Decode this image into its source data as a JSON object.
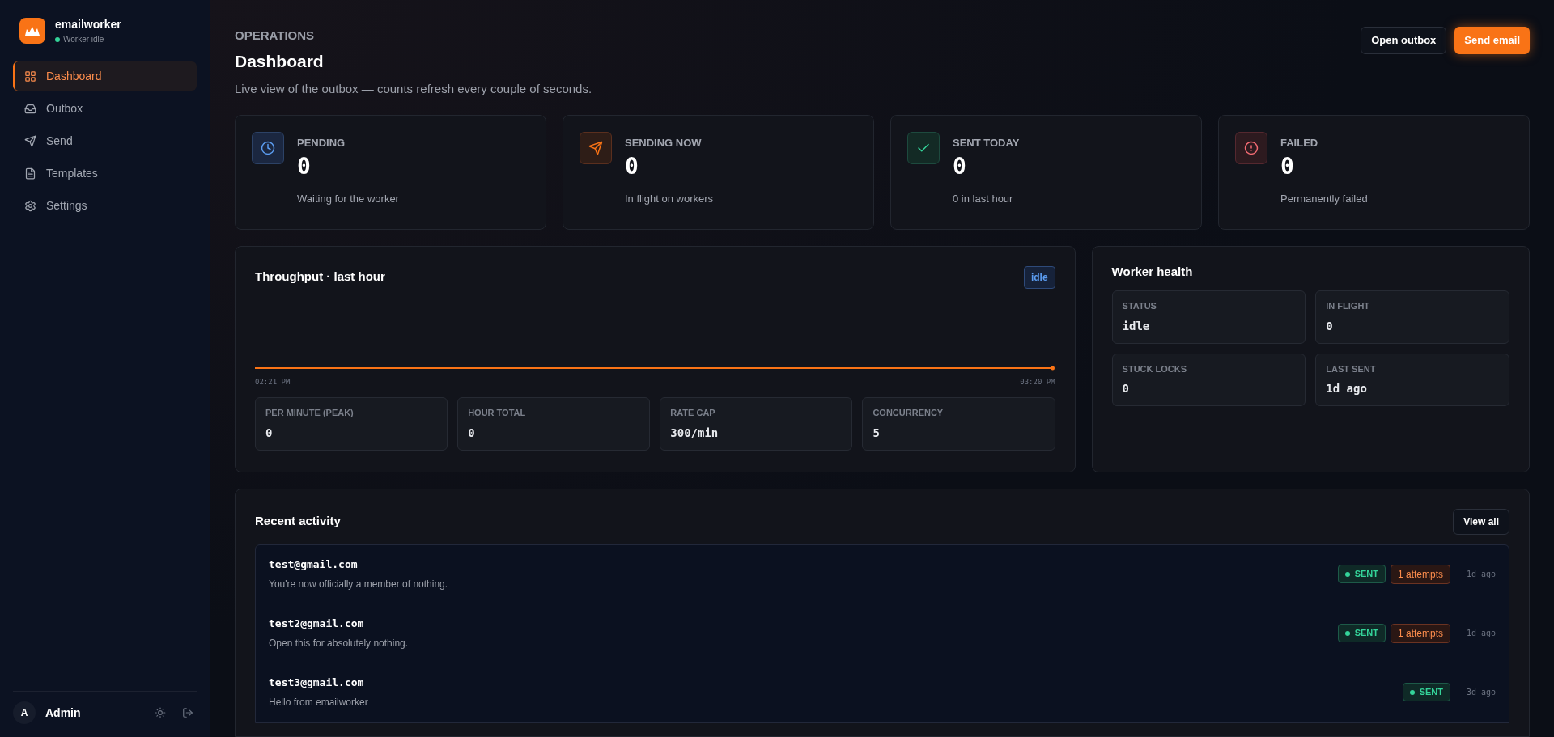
{
  "sidebar": {
    "app_name": "emailworker",
    "worker_status": "Worker idle",
    "items": [
      {
        "label": "Dashboard",
        "kind": "dashboard",
        "selected": true
      },
      {
        "label": "Outbox",
        "kind": "outbox",
        "selected": false
      },
      {
        "label": "Send",
        "kind": "send",
        "selected": false
      },
      {
        "label": "Templates",
        "kind": "templates",
        "selected": false
      },
      {
        "label": "Settings",
        "kind": "settings",
        "selected": false
      }
    ],
    "user": {
      "initial": "A",
      "name": "Admin"
    }
  },
  "header": {
    "eyebrow": "OPERATIONS",
    "title": "Dashboard",
    "subtitle": "Live view of the outbox — counts refresh every couple of seconds.",
    "buttons": [
      {
        "label": "Open outbox",
        "kind": "secondary"
      },
      {
        "label": "Send email",
        "kind": "primary"
      }
    ]
  },
  "stats": [
    {
      "kind": "pending",
      "label": "PENDING",
      "value": "0",
      "caption": "Waiting for the worker"
    },
    {
      "kind": "sending",
      "label": "SENDING NOW",
      "value": "0",
      "caption": "In flight on workers"
    },
    {
      "kind": "sent",
      "label": "SENT TODAY",
      "value": "0",
      "caption": "0 in last hour"
    },
    {
      "kind": "failed",
      "label": "FAILED",
      "value": "0",
      "caption": "Permanently failed"
    }
  ],
  "throughput": {
    "title": "Throughput · last hour",
    "badge": "idle",
    "x_start": "02:21 PM",
    "x_end": "03:20 PM",
    "metrics": [
      {
        "label": "PER MINUTE (PEAK)",
        "value": "0"
      },
      {
        "label": "HOUR TOTAL",
        "value": "0"
      },
      {
        "label": "RATE CAP",
        "value": "300/min"
      },
      {
        "label": "CONCURRENCY",
        "value": "5"
      }
    ]
  },
  "worker_health": {
    "title": "Worker health",
    "metrics": [
      {
        "label": "STATUS",
        "value": "idle"
      },
      {
        "label": "IN FLIGHT",
        "value": "0"
      },
      {
        "label": "STUCK LOCKS",
        "value": "0"
      },
      {
        "label": "LAST SENT",
        "value": "1d ago"
      }
    ]
  },
  "recent_activity": {
    "title": "Recent activity",
    "button": "View all",
    "rows": [
      {
        "email": "test@gmail.com",
        "subject": "You're now officially a member of nothing.",
        "badges": [
          {
            "kind": "status",
            "text": "SENT"
          },
          {
            "kind": "attempts",
            "text": "1 attempts"
          }
        ],
        "time": "1d ago"
      },
      {
        "email": "test2@gmail.com",
        "subject": "Open this for absolutely nothing.",
        "badges": [
          {
            "kind": "status",
            "text": "SENT"
          },
          {
            "kind": "attempts",
            "text": "1 attempts"
          }
        ],
        "time": "1d ago"
      },
      {
        "email": "test3@gmail.com",
        "subject": "Hello from emailworker",
        "badges": [
          {
            "kind": "status",
            "text": "SENT"
          }
        ],
        "time": "3d ago"
      }
    ]
  }
}
